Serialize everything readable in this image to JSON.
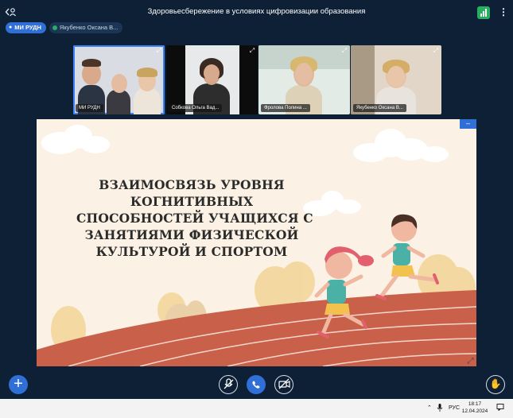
{
  "header": {
    "title": "Здоровьесбережение в условиях цифровизации образования",
    "signal_icon": "signal-bars-icon",
    "menu_icon": "kebab-menu-icon",
    "accent": "#27ae60"
  },
  "chips": [
    {
      "label": "МИ РУДН",
      "active": true
    },
    {
      "label": "Якубенко Оксана В...",
      "active": false
    }
  ],
  "participants": [
    {
      "name": "МИ РУДН"
    },
    {
      "name": "Собкова Ольга Вад..."
    },
    {
      "name": "Фролова Полина ..."
    },
    {
      "name": "Якубенко Оксана В..."
    }
  ],
  "slide": {
    "title_lines": [
      "ВЗАИМОСВЯЗЬ УРОВНЯ",
      "КОГНИТИВНЫХ",
      "СПОСОБНОСТЕЙ УЧАЩИХСЯ С",
      "ЗАНЯТИЯМИ ФИЗИЧЕСКОЙ",
      "КУЛЬТУРОЙ И СПОРТОМ"
    ],
    "minimize_label": "–"
  },
  "controls": {
    "add_label": "+",
    "mic_icon": "mic-off-icon",
    "call_icon": "phone-icon",
    "camera_icon": "camera-off-icon",
    "hand_icon": "raise-hand-icon"
  },
  "taskbar": {
    "language": "РУС",
    "time": "18:17",
    "date": "12.04.2024"
  },
  "colors": {
    "background": "#0e2036",
    "primary": "#2f6fd6",
    "slide_bg": "#fbf1e4",
    "track": "#c9604a"
  }
}
